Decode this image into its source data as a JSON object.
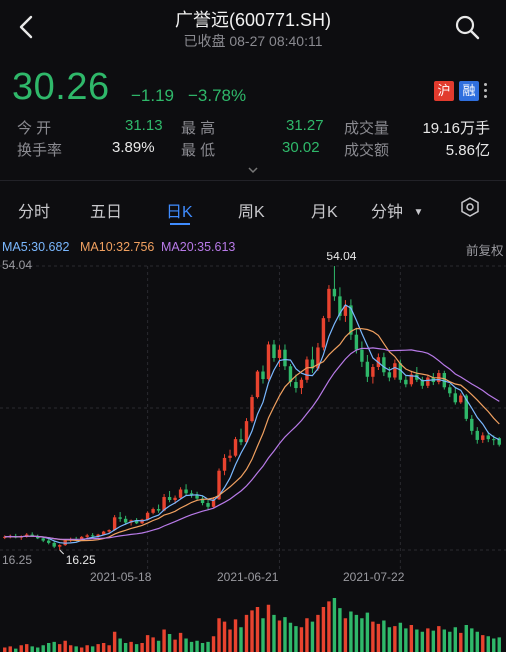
{
  "header": {
    "title": "广誉远(600771.SH)",
    "subtitle": "已收盘 08-27 08:40:11",
    "back_icon": "chevron-left-icon",
    "search_icon": "search-icon"
  },
  "quote": {
    "price": "30.26",
    "change": "−1.19",
    "change_pct": "−3.78%",
    "badges": [
      "沪",
      "融"
    ],
    "stats": [
      {
        "label": "今 开",
        "value": "31.13"
      },
      {
        "label": "最 高",
        "value": "31.27"
      },
      {
        "label": "成交量",
        "value": "19.16万手"
      },
      {
        "label": "换手率",
        "value": "3.89%"
      },
      {
        "label": "最 低",
        "value": "30.02"
      },
      {
        "label": "成交额",
        "value": "5.86亿"
      }
    ]
  },
  "tabs": [
    {
      "label": "分时"
    },
    {
      "label": "五日"
    },
    {
      "label": "日K",
      "active": true
    },
    {
      "label": "周K"
    },
    {
      "label": "月K"
    },
    {
      "label": "分钟"
    }
  ],
  "indicators": {
    "ma5": "MA5:30.682",
    "ma10": "MA10:32.756",
    "ma20": "MA20:35.613",
    "adjust": "前复权"
  },
  "colors": {
    "up": "#e8432f",
    "down": "#2fb86a",
    "ma5": "#7ab8ff",
    "ma10": "#f0a060",
    "ma20": "#b87ae8",
    "accent": "#3f8cff"
  },
  "chart_data": {
    "type": "candlestick",
    "y_top_label": "54.04",
    "y_bottom_label": "16.25",
    "high_label": "54.04",
    "low_label": "16.25",
    "ylim": [
      16.25,
      54.04
    ],
    "x_labels": [
      "2021-05-18",
      "2021-06-21",
      "2021-07-22"
    ],
    "ohlc": [
      [
        17.9,
        18.2,
        17.7,
        18.0
      ],
      [
        18.0,
        18.3,
        17.8,
        18.1
      ],
      [
        18.1,
        18.4,
        17.8,
        17.9
      ],
      [
        17.9,
        18.2,
        17.6,
        18.1
      ],
      [
        18.1,
        18.5,
        17.9,
        18.3
      ],
      [
        18.3,
        18.6,
        18.0,
        18.1
      ],
      [
        18.1,
        18.3,
        17.7,
        17.8
      ],
      [
        17.8,
        18.0,
        17.3,
        17.5
      ],
      [
        17.5,
        17.8,
        17.0,
        17.2
      ],
      [
        17.2,
        17.4,
        16.5,
        16.7
      ],
      [
        16.7,
        17.0,
        16.25,
        16.9
      ],
      [
        16.9,
        17.6,
        16.8,
        17.5
      ],
      [
        17.5,
        17.9,
        17.3,
        17.7
      ],
      [
        17.7,
        18.0,
        17.4,
        17.6
      ],
      [
        17.6,
        18.1,
        17.5,
        18.0
      ],
      [
        18.0,
        18.4,
        17.8,
        18.2
      ],
      [
        18.2,
        18.5,
        17.9,
        18.1
      ],
      [
        18.1,
        18.4,
        17.9,
        18.3
      ],
      [
        18.3,
        18.8,
        18.2,
        18.7
      ],
      [
        18.7,
        19.0,
        18.5,
        18.9
      ],
      [
        18.9,
        20.9,
        18.8,
        20.6
      ],
      [
        20.6,
        21.3,
        20.0,
        20.4
      ],
      [
        20.4,
        20.8,
        19.6,
        19.9
      ],
      [
        19.9,
        20.3,
        19.5,
        20.2
      ],
      [
        20.2,
        20.5,
        19.7,
        19.8
      ],
      [
        19.8,
        20.4,
        19.7,
        20.3
      ],
      [
        20.3,
        21.4,
        20.2,
        21.2
      ],
      [
        21.2,
        21.9,
        21.0,
        21.7
      ],
      [
        21.7,
        22.3,
        21.2,
        21.5
      ],
      [
        21.5,
        23.7,
        21.4,
        23.3
      ],
      [
        23.3,
        24.1,
        22.6,
        22.9
      ],
      [
        22.9,
        23.5,
        22.4,
        23.2
      ],
      [
        23.2,
        24.6,
        23.0,
        24.3
      ],
      [
        24.3,
        25.0,
        23.5,
        23.8
      ],
      [
        23.8,
        24.2,
        23.2,
        23.6
      ],
      [
        23.6,
        24.0,
        22.8,
        23.1
      ],
      [
        23.1,
        23.5,
        22.2,
        22.5
      ],
      [
        22.5,
        22.9,
        21.6,
        22.0
      ],
      [
        22.0,
        23.3,
        21.9,
        23.0
      ],
      [
        23.0,
        27.1,
        22.9,
        26.8
      ],
      [
        26.8,
        29.0,
        26.2,
        28.5
      ],
      [
        28.5,
        29.6,
        28.0,
        28.8
      ],
      [
        28.8,
        31.3,
        28.6,
        31.0
      ],
      [
        31.0,
        32.4,
        30.2,
        30.6
      ],
      [
        30.6,
        33.8,
        30.5,
        33.4
      ],
      [
        33.4,
        36.9,
        33.2,
        36.6
      ],
      [
        36.6,
        40.2,
        36.4,
        40.0
      ],
      [
        40.0,
        40.8,
        38.4,
        39.0
      ],
      [
        39.0,
        44.0,
        38.8,
        43.6
      ],
      [
        43.6,
        44.2,
        41.3,
        41.8
      ],
      [
        41.8,
        43.5,
        40.6,
        42.9
      ],
      [
        42.9,
        43.6,
        40.2,
        40.7
      ],
      [
        40.7,
        41.0,
        38.0,
        38.6
      ],
      [
        38.6,
        39.6,
        37.2,
        37.8
      ],
      [
        37.8,
        39.2,
        37.0,
        38.9
      ],
      [
        38.9,
        42.0,
        38.5,
        41.6
      ],
      [
        41.6,
        43.3,
        39.8,
        40.4
      ],
      [
        40.4,
        43.8,
        40.1,
        43.2
      ],
      [
        43.2,
        47.4,
        42.8,
        47.1
      ],
      [
        47.1,
        51.5,
        46.6,
        51.0
      ],
      [
        51.0,
        54.04,
        49.4,
        50.0
      ],
      [
        50.0,
        51.2,
        46.8,
        47.4
      ],
      [
        47.4,
        49.5,
        46.6,
        48.8
      ],
      [
        48.8,
        49.6,
        44.2,
        44.9
      ],
      [
        44.9,
        45.8,
        42.4,
        42.9
      ],
      [
        42.9,
        44.0,
        40.6,
        41.3
      ],
      [
        41.3,
        42.2,
        38.6,
        39.3
      ],
      [
        39.3,
        41.0,
        38.4,
        40.6
      ],
      [
        40.6,
        42.4,
        40.2,
        41.9
      ],
      [
        41.9,
        42.5,
        39.4,
        39.9
      ],
      [
        39.9,
        40.6,
        38.7,
        39.2
      ],
      [
        39.2,
        41.6,
        38.9,
        41.1
      ],
      [
        41.1,
        41.6,
        38.5,
        38.9
      ],
      [
        38.9,
        39.4,
        37.9,
        38.3
      ],
      [
        38.3,
        40.1,
        38.0,
        39.6
      ],
      [
        39.6,
        40.6,
        38.6,
        38.9
      ],
      [
        38.9,
        39.3,
        37.7,
        38.1
      ],
      [
        38.1,
        39.6,
        37.8,
        39.2
      ],
      [
        39.2,
        39.8,
        38.2,
        38.6
      ],
      [
        38.6,
        40.2,
        38.3,
        39.8
      ],
      [
        39.8,
        40.1,
        37.6,
        37.9
      ],
      [
        37.9,
        38.3,
        36.6,
        37.1
      ],
      [
        37.1,
        37.8,
        35.6,
        35.9
      ],
      [
        35.9,
        37.1,
        35.7,
        36.8
      ],
      [
        36.8,
        37.0,
        33.4,
        33.7
      ],
      [
        33.7,
        34.2,
        31.6,
        32.1
      ],
      [
        32.1,
        32.6,
        30.4,
        30.9
      ],
      [
        30.9,
        31.9,
        30.5,
        31.5
      ],
      [
        31.5,
        32.0,
        30.6,
        31.0
      ],
      [
        31.0,
        31.5,
        30.2,
        30.9
      ],
      [
        31.13,
        31.27,
        30.02,
        30.26
      ]
    ],
    "volume": [
      4,
      5,
      3,
      6,
      7,
      5,
      4,
      6,
      8,
      9,
      7,
      10,
      6,
      5,
      4,
      6,
      5,
      7,
      8,
      6,
      18,
      12,
      8,
      9,
      7,
      8,
      15,
      13,
      10,
      20,
      16,
      11,
      17,
      12,
      9,
      10,
      8,
      9,
      14,
      30,
      27,
      20,
      29,
      22,
      33,
      37,
      40,
      30,
      42,
      33,
      28,
      31,
      26,
      23,
      22,
      30,
      27,
      33,
      40,
      45,
      48,
      39,
      30,
      36,
      33,
      30,
      35,
      27,
      25,
      28,
      22,
      23,
      26,
      21,
      24,
      20,
      18,
      21,
      19,
      23,
      20,
      18,
      22,
      17,
      24,
      21,
      18,
      15,
      14,
      12,
      13
    ]
  }
}
